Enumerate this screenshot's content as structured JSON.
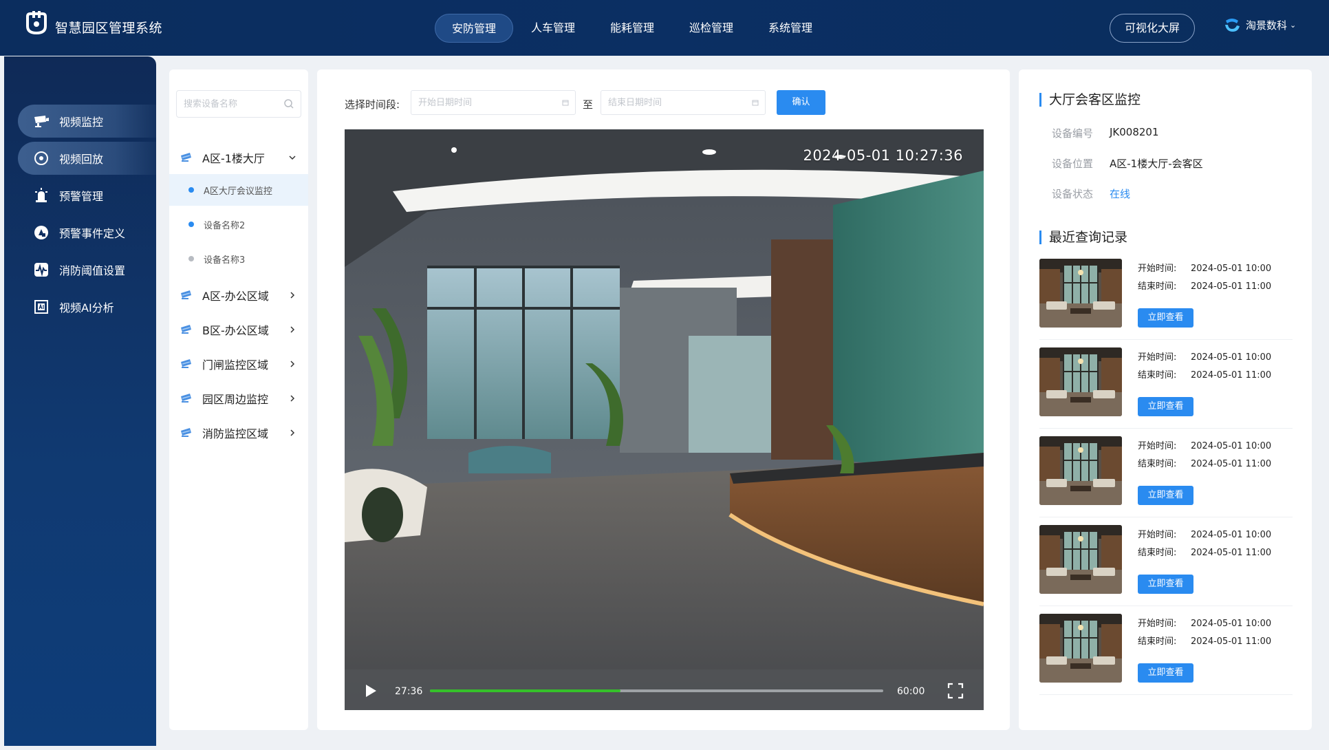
{
  "header": {
    "logo_icon": "park-logo-icon",
    "app_title": "智慧园区管理系统",
    "nav": [
      {
        "label": "安防管理",
        "active": true
      },
      {
        "label": "人车管理",
        "active": false
      },
      {
        "label": "能耗管理",
        "active": false
      },
      {
        "label": "巡检管理",
        "active": false
      },
      {
        "label": "系统管理",
        "active": false
      }
    ],
    "bigscreen_label": "可视化大屏",
    "brand_label": "淘景数科",
    "brand_icon": "brand-logo-icon"
  },
  "sidebar": {
    "items": [
      {
        "label": "视频监控",
        "icon": "camera-icon",
        "active": true
      },
      {
        "label": "视频回放",
        "icon": "playback-icon",
        "active": true
      },
      {
        "label": "预警管理",
        "icon": "alarm-icon",
        "active": false
      },
      {
        "label": "预警事件定义",
        "icon": "event-define-icon",
        "active": false
      },
      {
        "label": "消防阈值设置",
        "icon": "threshold-icon",
        "active": false
      },
      {
        "label": "视频AI分析",
        "icon": "ai-analysis-icon",
        "active": false
      }
    ]
  },
  "tree": {
    "search_placeholder": "搜索设备名称",
    "groups": [
      {
        "label": "A区-1楼大厅",
        "expanded": true
      },
      {
        "label": "A区-办公区域",
        "expanded": false
      },
      {
        "label": "B区-办公区域",
        "expanded": false
      },
      {
        "label": "门闸监控区域",
        "expanded": false
      },
      {
        "label": "园区周边监控",
        "expanded": false
      },
      {
        "label": "消防监控区域",
        "expanded": false
      }
    ],
    "devices": [
      {
        "label": "A区大厅会议监控",
        "status": "online",
        "active": true
      },
      {
        "label": "设备名称2",
        "status": "online",
        "active": false
      },
      {
        "label": "设备名称3",
        "status": "offline",
        "active": false
      }
    ],
    "colors": {
      "online": "#2a8bf0",
      "offline": "#b8bcc2"
    }
  },
  "filter": {
    "time_label": "选择时间段:",
    "start_placeholder": "开始日期时间",
    "to_label": "至",
    "end_placeholder": "结束日期时间",
    "confirm_label": "确认"
  },
  "player": {
    "timestamp": "2024-05-01 10:27:36",
    "current_time": "27:36",
    "total_time": "60:00",
    "progress_fraction": 0.42
  },
  "device_info": {
    "title": "大厅会客区监控",
    "rows": [
      {
        "key": "设备编号",
        "value": "JK008201"
      },
      {
        "key": "设备位置",
        "value": "A区-1楼大厅-会客区"
      },
      {
        "key": "设备状态",
        "value": "在线"
      }
    ]
  },
  "records": {
    "title": "最近查询记录",
    "start_key": "开始时间:",
    "end_key": "结束时间:",
    "button_label": "立即查看",
    "items": [
      {
        "start": "2024-05-01 10:00",
        "end": "2024-05-01 11:00"
      },
      {
        "start": "2024-05-01 10:00",
        "end": "2024-05-01 11:00"
      },
      {
        "start": "2024-05-01 10:00",
        "end": "2024-05-01 11:00"
      },
      {
        "start": "2024-05-01 10:00",
        "end": "2024-05-01 11:00"
      },
      {
        "start": "2024-05-01 10:00",
        "end": "2024-05-01 11:00"
      }
    ]
  },
  "colors": {
    "accent": "#2a8bf0",
    "header_bg": "#0b2d5e",
    "progress": "#35c12a"
  }
}
